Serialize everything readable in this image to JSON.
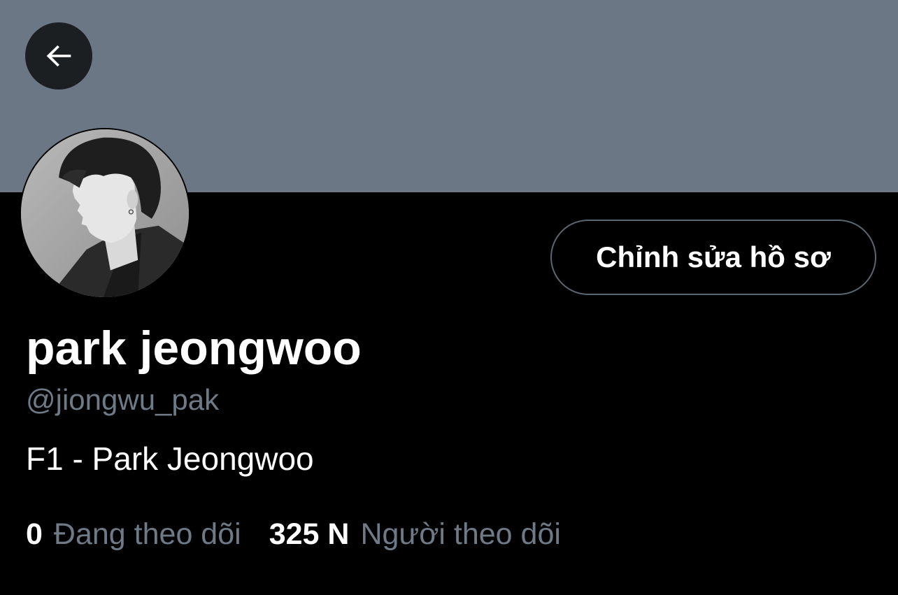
{
  "banner": {
    "color": "#6b7785"
  },
  "back_button": {
    "icon": "arrow-left-icon"
  },
  "avatar": {
    "description_icon": "profile-photo"
  },
  "edit_profile_button": {
    "label": "Chỉnh sửa hồ sơ"
  },
  "profile": {
    "display_name": "park jeongwoo",
    "handle": "@jiongwu_pak",
    "bio": "F1 - Park Jeongwoo"
  },
  "stats": {
    "following": {
      "count": "0",
      "label": "Đang theo dõi"
    },
    "followers": {
      "count": "325 N",
      "label": "Người theo dõi"
    }
  },
  "colors": {
    "background": "#000000",
    "muted_text": "#6e7a86",
    "button_border": "#5c6670"
  }
}
